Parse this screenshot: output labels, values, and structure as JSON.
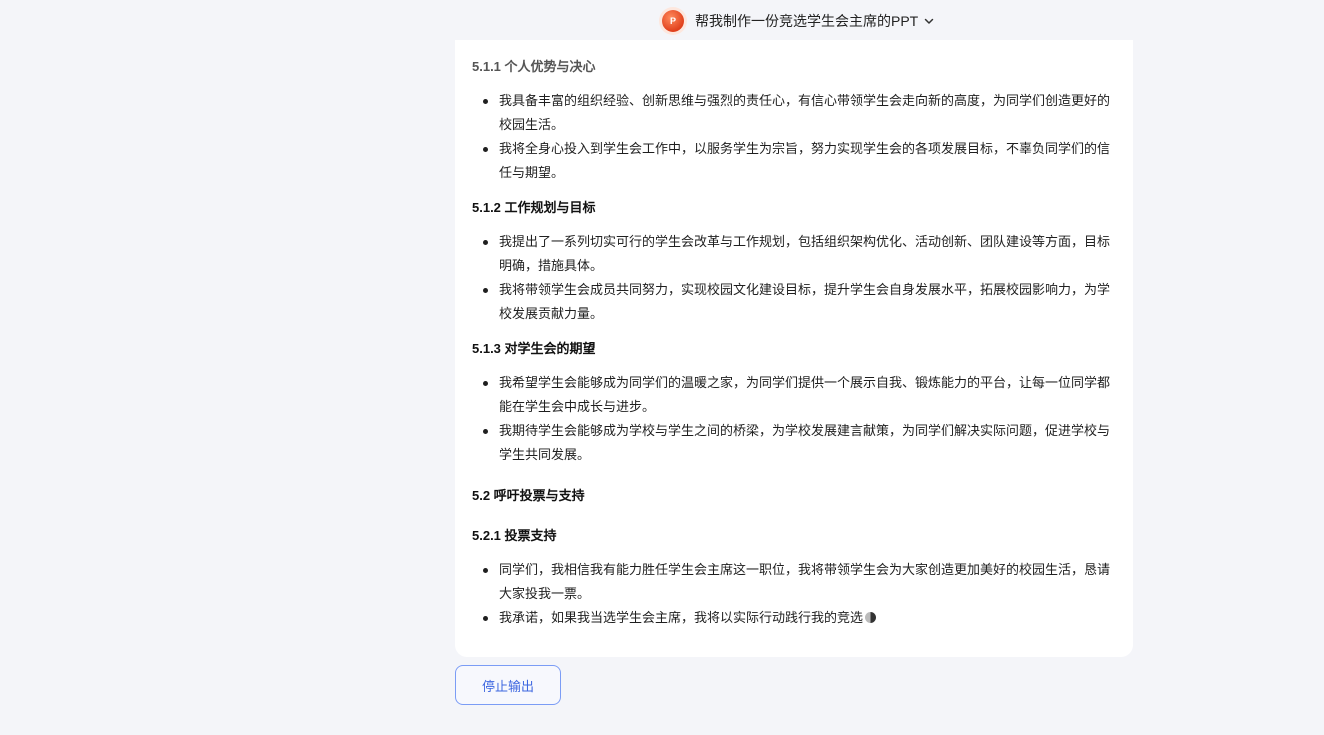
{
  "header": {
    "title": "帮我制作一份竞选学生会主席的PPT",
    "app_icon": "ppt-icon",
    "app_icon_text": "P",
    "accent": "#e0401c"
  },
  "content": {
    "s511": {
      "heading": "5.1.1 个人优势与决心",
      "items": [
        "我具备丰富的组织经验、创新思维与强烈的责任心，有信心带领学生会走向新的高度，为同学们创造更好的校园生活。",
        "我将全身心投入到学生会工作中，以服务学生为宗旨，努力实现学生会的各项发展目标，不辜负同学们的信任与期望。"
      ]
    },
    "s512": {
      "heading": "5.1.2 工作规划与目标",
      "items": [
        "我提出了一系列切实可行的学生会改革与工作规划，包括组织架构优化、活动创新、团队建设等方面，目标明确，措施具体。",
        "我将带领学生会成员共同努力，实现校园文化建设目标，提升学生会自身发展水平，拓展校园影响力，为学校发展贡献力量。"
      ]
    },
    "s513": {
      "heading": "5.1.3 对学生会的期望",
      "items": [
        "我希望学生会能够成为同学们的温暖之家，为同学们提供一个展示自我、锻炼能力的平台，让每一位同学都能在学生会中成长与进步。",
        "我期待学生会能够成为学校与学生之间的桥梁，为学校发展建言献策，为同学们解决实际问题，促进学校与学生共同发展。"
      ]
    },
    "s52": {
      "heading": "5.2 呼吁投票与支持"
    },
    "s521": {
      "heading": "5.2.1 投票支持",
      "items": [
        "同学们，我相信我有能力胜任学生会主席这一职位，我将带领学生会为大家创造更加美好的校园生活，恳请大家投我一票。",
        "我承诺，如果我当选学生会主席，我将以实际行动践行我的竞选"
      ]
    }
  },
  "actions": {
    "stop_label": "停止输出",
    "accent": "#3e67e0"
  }
}
